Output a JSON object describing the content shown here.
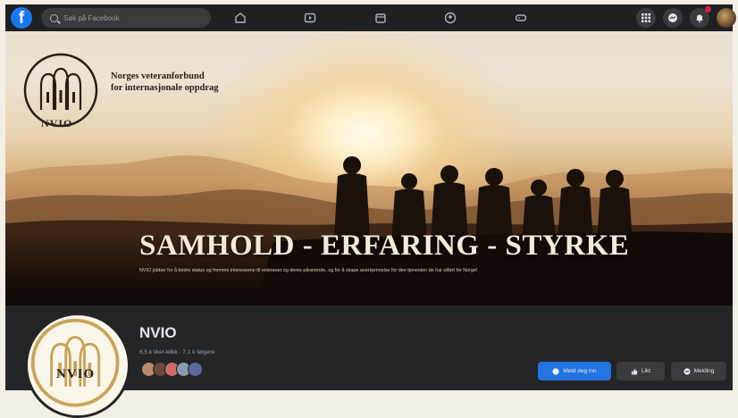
{
  "topbar": {
    "logo": "facebook-logo",
    "search_placeholder": "Søk på Facebook",
    "nav_icons": [
      "home-icon",
      "watch-icon",
      "marketplace-icon",
      "groups-icon",
      "gaming-icon"
    ],
    "right_icons": [
      "menu-grid-icon",
      "messenger-icon",
      "notifications-icon",
      "profile-avatar"
    ]
  },
  "cover": {
    "logo_text": "NVIO",
    "org_name_line1": "Norges veteranforbund",
    "org_name_line2": "for internasjonale oppdrag",
    "headline": "SAMHOLD - ERFARING - STYRKE",
    "tagline": "NVIO jobber for å bedre status og fremme interessene til veteraner og deres pårørende, og for å skape anerkjennelse for den tjenesten de har utført for Norge!"
  },
  "profile": {
    "logo_text": "NVIO",
    "name": "NVIO",
    "stats": "6,5 k liker-klikk · 7,1 k følgere"
  },
  "actions": {
    "primary": "Meld deg inn",
    "like": "Likt",
    "message": "Melding"
  },
  "colors": {
    "topbar": "#1f2022",
    "profile_bg": "#242526",
    "accent": "#2374e1",
    "button_bg": "#3a3b3c",
    "logo_gold": "#c9a35a"
  }
}
